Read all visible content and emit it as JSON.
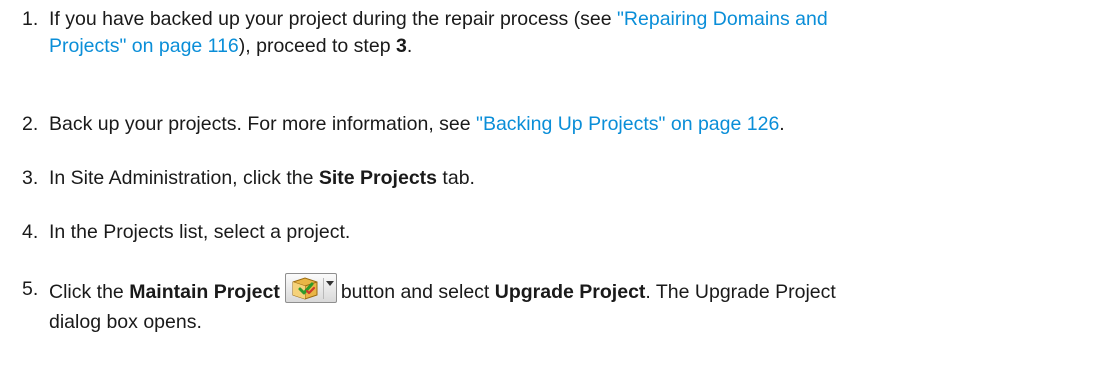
{
  "steps": [
    {
      "num": "1.",
      "text_before": "If you have backed up your project during the repair process (see ",
      "link_part1": "\"Repairing Domains and",
      "link_part2": "Projects\" on page 116",
      "text_mid": "), proceed to step ",
      "bold": "3",
      "text_after": "."
    },
    {
      "num": "2.",
      "text_before": "Back up your projects. For more information, see ",
      "link": "\"Backing Up Projects\" on page 126",
      "text_after": "."
    },
    {
      "num": "3.",
      "text_before": "In Site Administration, click the ",
      "bold": "Site Projects",
      "text_after": " tab."
    },
    {
      "num": "4.",
      "text": "In the Projects list, select a project."
    },
    {
      "num": "5.",
      "text_before": "Click the ",
      "bold1": "Maintain Project",
      "text_mid": "button and select ",
      "bold2": "Upgrade Project",
      "text_after": ". The Upgrade Project",
      "text_line2": "dialog box opens.",
      "icon": "maintain-project-dropdown-icon"
    }
  ]
}
